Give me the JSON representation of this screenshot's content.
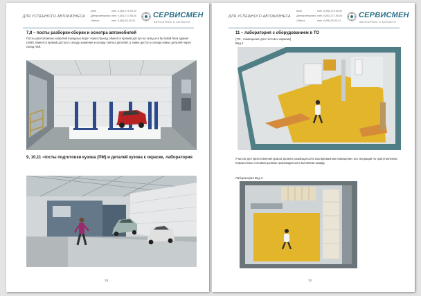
{
  "header": {
    "tag": "ДЛЯ УСПЕШНОГО АВТОБИЗНЕСА",
    "cities": [
      "Киев",
      "Днепропетровск",
      "Одесса"
    ],
    "phones": [
      "тел. 0-(99)-179-00-02",
      "тел. 0-(50)-717-65-00",
      "тел. 0-(95)-53-00-41"
    ],
    "brand": "СЕРВИСМЕН",
    "brand_sub": "АВТОСЕРВИС И ЗАПЧАСТИ",
    "logo_icon": "gear-logo-icon",
    "accent_color": "#2a6f88"
  },
  "left_page": {
    "section1_title": "7,8 – посты разборки-сборки и осмотра автомобилей",
    "section1_text": "Посты расположены напротив въездных ворот через проезд. Имеется прямой доступ на склад и в бытовой блок здания (АБК). Имеется прямой доступ к складу хранения и складу снятых деталей, а также доступ к складу новых деталей через склад АБК.",
    "section2_title": "9, 10,11 -посты подготовки кузова (ПМ) и деталей кузова к окраске, лаборатория",
    "page_number": "29"
  },
  "right_page": {
    "section_title": "11 – лаборатория с оборудованием в ТО",
    "section_note": "(ТО - помещение для тестов и окраски)",
    "view1_label": "Вид 1",
    "body_text": "Участок для приготовления красок должен размещаться в изолированном помещении, все операции по приготовлению покрасочных составов должны производиться в вытяжном шкафу.",
    "view2_label": "Лаборатория Вид 2",
    "page_number": "30"
  }
}
